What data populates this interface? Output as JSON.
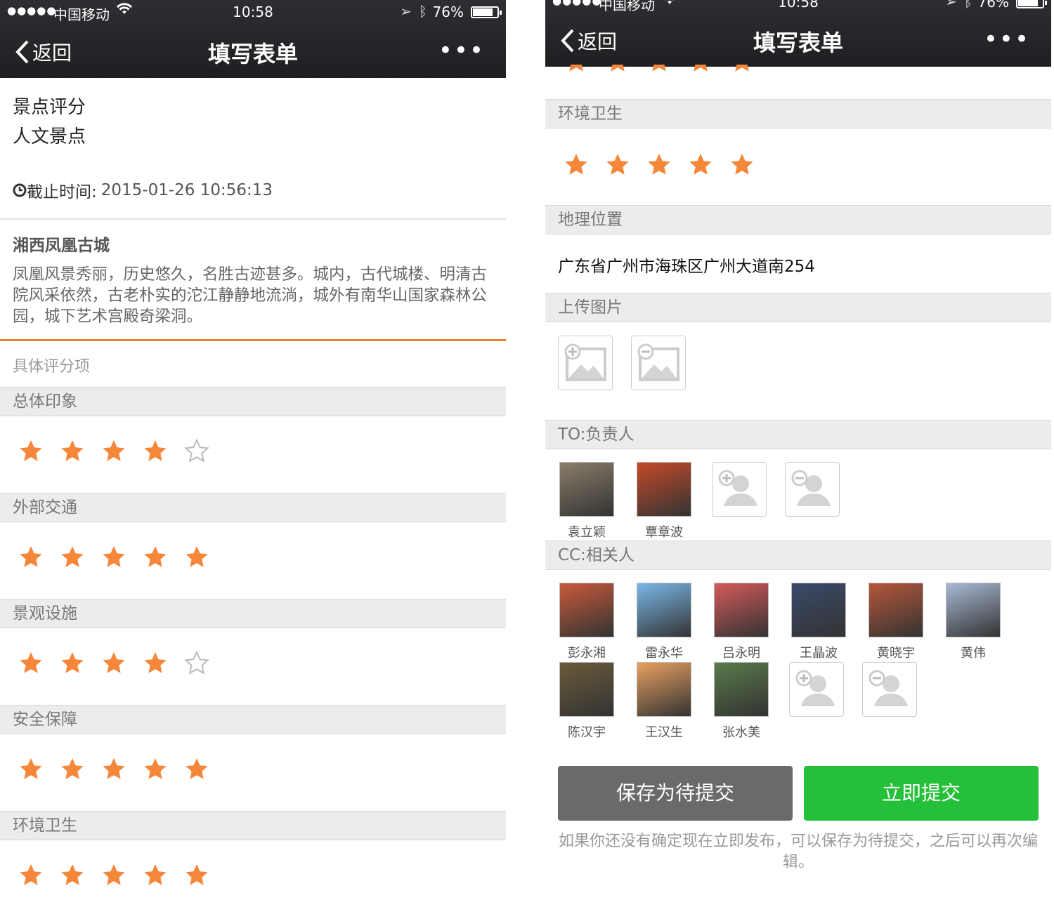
{
  "status": {
    "carrier": "中国移动",
    "time": "10:58",
    "battery": "76%",
    "signal": "●●●●●"
  },
  "nav": {
    "back_label": "返回",
    "title": "填写表单",
    "more": "•••"
  },
  "left": {
    "heading_line1": "景点评分",
    "heading_line2": "人文景点",
    "deadline_label": "截止时间:",
    "deadline_value": "2015-01-26 10:56:13",
    "place_title": "湘西凤凰古城",
    "place_desc": "凤凰风景秀丽，历史悠久，名胜古迹甚多。城内，古代城楼、明清古院风采依然，古老朴实的沱江静静地流淌，城外有南华山国家森林公园，城下艺术宫殿奇梁洞。",
    "sub_head": "具体评分项",
    "ratings": [
      {
        "label": "总体印象",
        "score": 4,
        "max": 5
      },
      {
        "label": "外部交通",
        "score": 5,
        "max": 5
      },
      {
        "label": "景观设施",
        "score": 4,
        "max": 5
      },
      {
        "label": "安全保障",
        "score": 5,
        "max": 5
      },
      {
        "label": "环境卫生",
        "score": 5,
        "max": 5
      }
    ]
  },
  "right": {
    "hygiene": {
      "label": "环境卫生",
      "score": 5,
      "max": 5
    },
    "location_label": "地理位置",
    "location_value": "广东省广州市海珠区广州大道南254",
    "upload_label": "上传图片",
    "to_label": "TO:负责人",
    "to_people": [
      "袁立颖",
      "覃章波"
    ],
    "cc_label": "CC:相关人",
    "cc_people": [
      "彭永湘",
      "雷永华",
      "吕永明",
      "王晶波",
      "黄晓宇",
      "黄伟",
      "陈汉宇",
      "王汉生",
      "张水美"
    ],
    "save_button": "保存为待提交",
    "submit_button": "立即提交",
    "hint": "如果你还没有确定现在立即发布，可以保存为待提交，之后可以再次编辑。"
  },
  "colors": {
    "star_orange": "#f5873a",
    "accent_orange": "#ef7e2c",
    "submit_green": "#25c039",
    "save_gray": "#6a6a6a"
  },
  "icons": [
    "back-chevron-icon",
    "more-icon",
    "wifi-icon",
    "location-arrow-icon",
    "bluetooth-icon",
    "battery-icon",
    "clock-icon",
    "star-filled-icon",
    "star-empty-icon",
    "add-image-icon",
    "remove-image-icon",
    "add-person-icon",
    "remove-person-icon"
  ]
}
